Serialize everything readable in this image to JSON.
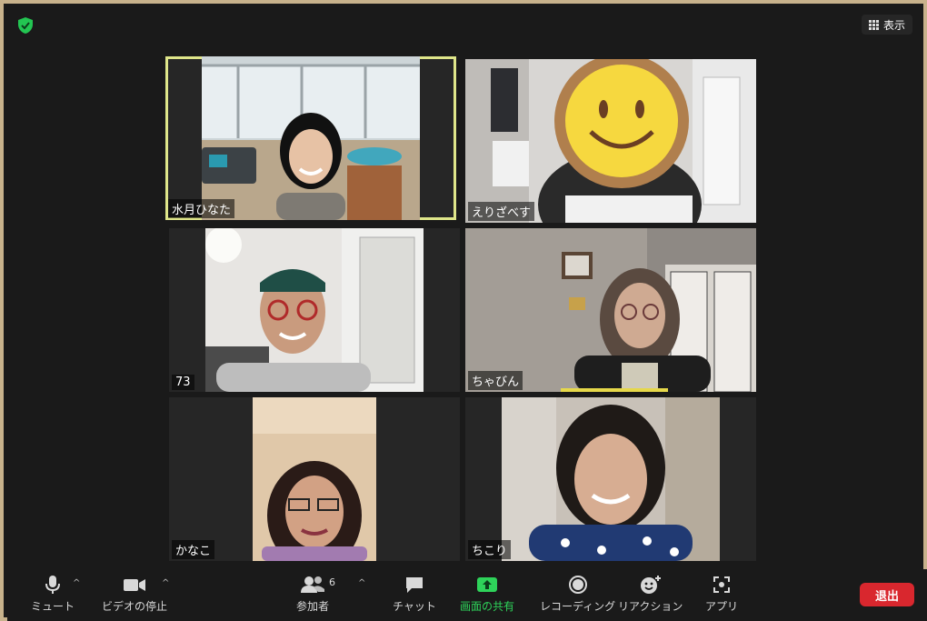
{
  "header": {
    "view_label": "表示"
  },
  "participants": [
    {
      "name": "水月ひなた",
      "active": true
    },
    {
      "name": "えりざべす"
    },
    {
      "name": "73"
    },
    {
      "name": "ちゃびん"
    },
    {
      "name": "かなこ"
    },
    {
      "name": "ちこり"
    }
  ],
  "toolbar": {
    "mute_label": "ミュート",
    "video_label": "ビデオの停止",
    "participants_label": "参加者",
    "participants_count": "6",
    "chat_label": "チャット",
    "share_label": "画面の共有",
    "record_label": "レコーディング",
    "reaction_label": "リアクション",
    "apps_label": "アプリ",
    "leave_label": "退出"
  },
  "colors": {
    "share_green": "#2ed35a",
    "leave_red": "#d9272e",
    "active_border": "#dfe68a"
  }
}
